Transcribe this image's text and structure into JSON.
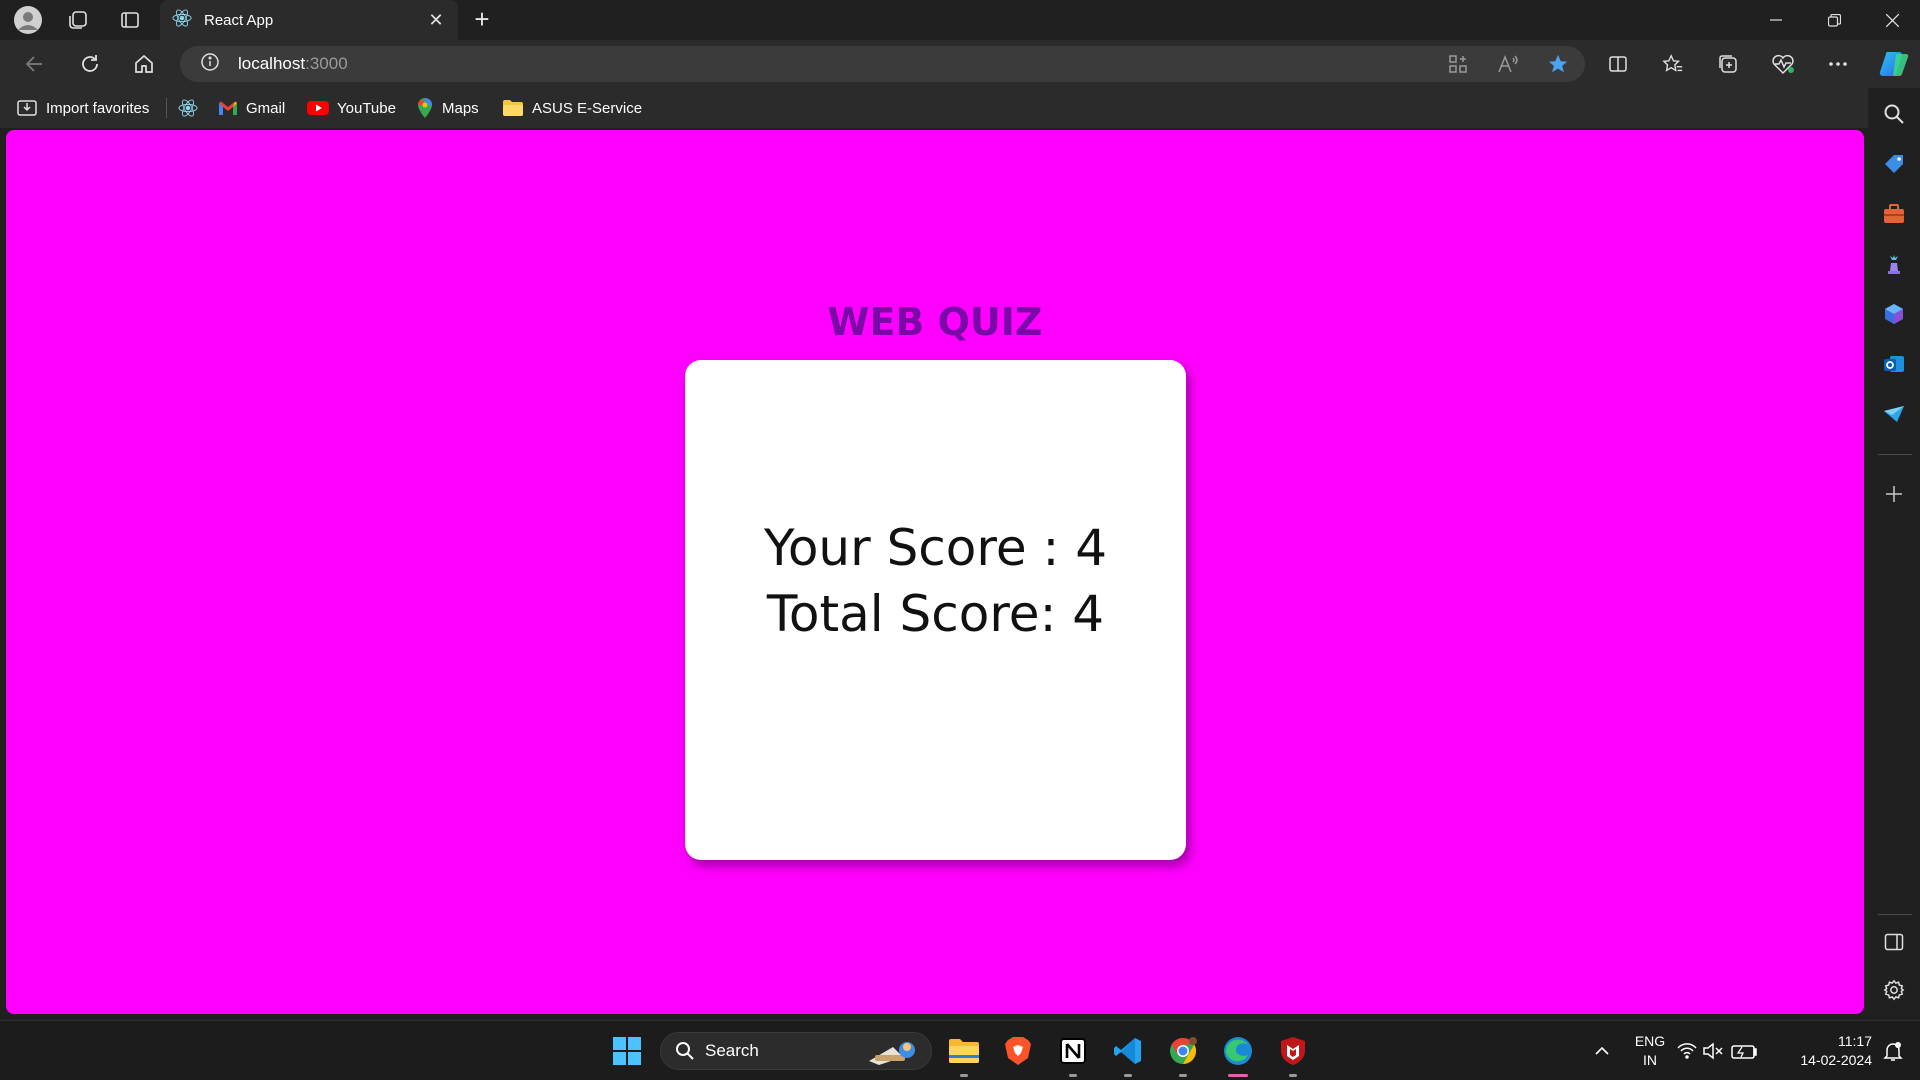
{
  "browser": {
    "tab_title": "React App",
    "url_host": "localhost",
    "url_port": ":3000",
    "bookmarks": [
      {
        "label": "Import favorites",
        "icon": "import-favorites-icon"
      },
      {
        "label": "",
        "icon": "react-icon"
      },
      {
        "label": "Gmail",
        "icon": "gmail-icon"
      },
      {
        "label": "YouTube",
        "icon": "youtube-icon"
      },
      {
        "label": "Maps",
        "icon": "maps-icon"
      },
      {
        "label": "ASUS E-Service",
        "icon": "folder-icon"
      }
    ]
  },
  "page": {
    "background": "#ff00ff",
    "title": "WEB QUIZ",
    "title_color": "#7a0aa8",
    "your_score_line": "Your Score : 4",
    "total_score_line": "Total Score: 4"
  },
  "taskbar": {
    "search_label": "Search",
    "language": "ENG",
    "region": "IN",
    "time": "11:17",
    "date": "14-02-2024"
  }
}
